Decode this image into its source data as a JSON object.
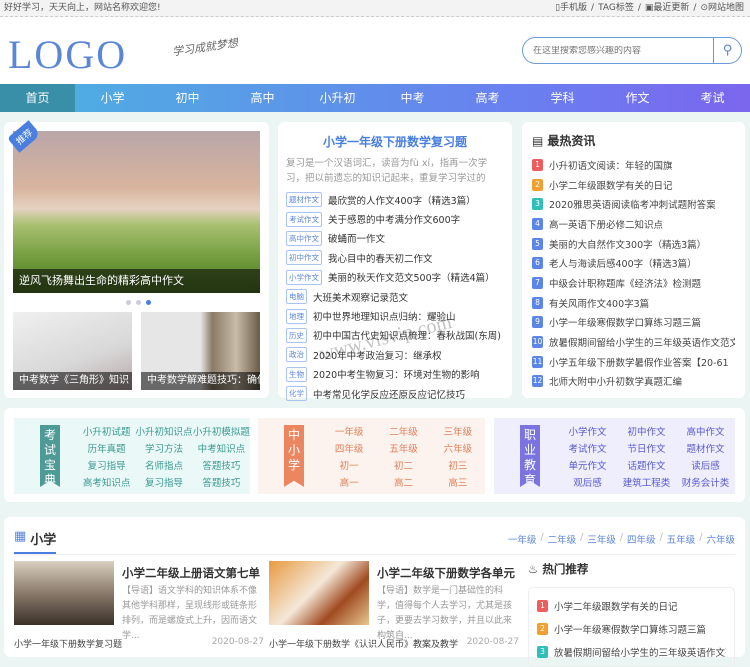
{
  "topbar": {
    "welcome": "好好学习，天天向上，网站名称欢迎您!",
    "links": [
      {
        "icon": "mobile-icon",
        "label": "▯手机版"
      },
      {
        "icon": "",
        "label": "TAG标签"
      },
      {
        "icon": "update-icon",
        "label": "▣最近更新"
      },
      {
        "icon": "map-pin-icon",
        "label": "⊙网站地图"
      }
    ]
  },
  "header": {
    "logo": "LOGO",
    "slogan": "学习成就梦想",
    "search_placeholder": "在这里搜索您感兴趣的内容"
  },
  "nav": [
    "首页",
    "小学",
    "初中",
    "高中",
    "小升初",
    "中考",
    "高考",
    "学科",
    "作文",
    "考试"
  ],
  "slider": {
    "badge": "推荐",
    "caption": "逆风飞扬舞出生命的精彩高中作文",
    "active_dot": 3,
    "dot_count": 3,
    "thumbs": [
      "中考数学《三角形》知识",
      "中考数学解难题技巧：确保"
    ]
  },
  "featured": {
    "title": "小学一年级下册数学复习题",
    "intro": "复习是一个汉语词汇，读音为fù xí，指再一次学习，把以前遗忘的知识记起来，重复学习学过的",
    "items": [
      {
        "tag": "题材作文",
        "text": "最欣赏的人作文400字（精选3篇）"
      },
      {
        "tag": "考试作文",
        "text": "关于感恩的中考满分作文600字"
      },
      {
        "tag": "高中作文",
        "text": "破蛹而一作文"
      },
      {
        "tag": "初中作文",
        "text": "我心目中的春天初二作文"
      },
      {
        "tag": "小学作文",
        "text": "美丽的秋天作文范文500字（精选4篇）"
      },
      {
        "tag": "电脑",
        "text": "大班美术观察记录范文"
      },
      {
        "tag": "地理",
        "text": "初中世界地理知识点归纳：耀验山"
      },
      {
        "tag": "历史",
        "text": "初中中国古代史知识点梳理：春秋战国(东周)"
      },
      {
        "tag": "政治",
        "text": "2020年中考政治复习：继承权"
      },
      {
        "tag": "生物",
        "text": "2020中考生物复习：环境对生物的影响"
      },
      {
        "tag": "化学",
        "text": "中考常见化学反应还原反应记忆技巧"
      }
    ],
    "watermark": "www.visvip.com"
  },
  "hot_news": {
    "title": "最热资讯",
    "items": [
      "小升初语文阅读：年轻的国旗",
      "小学二年级跟数学有关的日记",
      "2020雅思英语阅读临考冲刺试题附答案",
      "高一英语下册必修二知识点",
      "美丽的大自然作文300字（精选3篇）",
      "老人与海读后感400字（精选3篇）",
      "中级会计职称题库《经济法》检测题",
      "有关风雨作文400字3篇",
      "小学一年级寒假数学口算练习题三篇",
      "放暑假期间留给小学生的三年级英语作文范文",
      "小学五年级下册数学暑假作业答案【20-61",
      "北师大附中小升初数学真题汇编"
    ]
  },
  "categories": [
    {
      "title": "考试宝典",
      "color": "#4e9a95",
      "bg": "#eaf8f8",
      "text_color": "#3a9a8f",
      "links": [
        "小升初试题",
        "小升初知识点",
        "小升初模拟题",
        "历年真题",
        "学习方法",
        "中考知识点",
        "复习指导",
        "名师指点",
        "答题技巧",
        "高考知识点",
        "复习指导",
        "答题技巧"
      ]
    },
    {
      "title": "中小学",
      "color": "#ec8660",
      "bg": "#fdf3ee",
      "text_color": "#e0805a",
      "links": [
        "一年级",
        "二年级",
        "三年级",
        "四年级",
        "五年级",
        "六年级",
        "初一",
        "初二",
        "初三",
        "高一",
        "高二",
        "高三"
      ]
    },
    {
      "title": "职业教育",
      "color": "#7b74e0",
      "bg": "#eeeefc",
      "text_color": "#5a5ad0",
      "links": [
        "小学作文",
        "初中作文",
        "高中作文",
        "考试作文",
        "节日作文",
        "题材作文",
        "单元作文",
        "话题作文",
        "读后感",
        "观后感",
        "建筑工程类",
        "财务会计类"
      ]
    }
  ],
  "section": {
    "title": "小学",
    "grades": [
      "一年级",
      "二年级",
      "三年级",
      "四年级",
      "五年级",
      "六年级"
    ],
    "articles": [
      {
        "title": "小学二年级上册语文第七单",
        "summary": "【导语】语文学科的知识体系不像其他学科那样，呈现线形或链条形排列，而是螺旋式上升，因而语文学...",
        "foot": "小学一年级下册数学复习题",
        "date": "2020-08-27"
      },
      {
        "title": "小学二年级下册数学各单元",
        "summary": "【导语】数学是一门基础性的科学，值得每个人去学习，尤其是孩子，更要去学习数学，并且以此来构筑自...",
        "foot": "小学一年级下册数学《认识人民币》教案及教学",
        "date": "2020-08-27"
      }
    ],
    "hot": {
      "title": "热门推荐",
      "items": [
        "小学二年级跟数学有关的日记",
        "小学一年级寒假数学口算练习题三篇",
        "放暑假期间留给小学生的三年级英语作文范"
      ]
    }
  },
  "colors": {
    "accent": "#4a7fe0",
    "rank": [
      "#ec5d5d",
      "#f0a030",
      "#2ec0b8",
      "#5b86e8"
    ]
  }
}
